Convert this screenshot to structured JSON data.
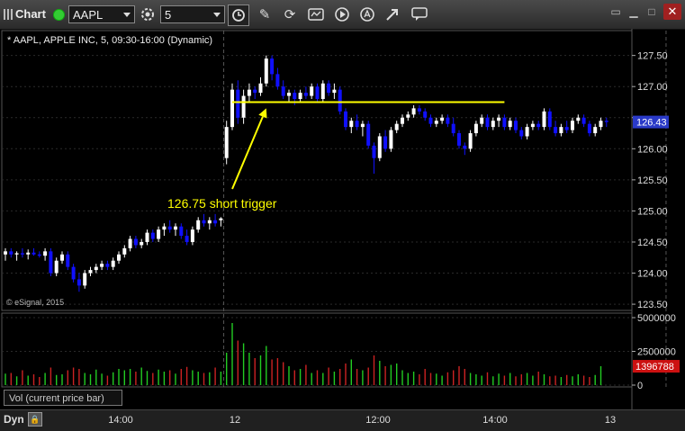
{
  "window": {
    "title": "Chart",
    "symbol": "AAPL",
    "interval": "5",
    "icons": [
      "clock-icon",
      "pencil-icon",
      "refresh-icon",
      "study-icon",
      "play-icon",
      "alert-icon",
      "link-icon",
      "comment-icon"
    ]
  },
  "chart_data": [
    {
      "type": "candlestick",
      "title": "* AAPL, APPLE INC, 5, 09:30-16:00 (Dynamic)",
      "watermark": "© eSignal, 2015",
      "y_ticks": [
        123.5,
        124.0,
        124.5,
        125.0,
        125.5,
        126.0,
        126.5,
        127.0,
        127.5
      ],
      "y_tick_labels": [
        "123.50",
        "124.00",
        "124.50",
        "125.00",
        "125.50",
        "126.00",
        "",
        "127.00",
        "127.50"
      ],
      "ylim": [
        123.4,
        127.9
      ],
      "x_tick_labels": [
        "14:00",
        "12",
        "12:00",
        "14:00",
        "13"
      ],
      "last_price": 126.43,
      "last_price_label": "126.43",
      "colors": {
        "up": "#ffffff",
        "down": "#1010ff",
        "horizontal_line": "#ffff00",
        "annotation": "#ffff00",
        "last_price_box": "#2a3ac8"
      },
      "horizontal_line": {
        "value": 126.75,
        "from_bar": 40,
        "to_bar": 88
      },
      "annotation": {
        "text": "126.75 short trigger",
        "arrow_to_bar": 46,
        "arrow_to_value": 126.65
      },
      "session_breaks": [
        38,
        116
      ],
      "candles": [
        [
          124.3,
          124.4,
          124.2,
          124.35
        ],
        [
          124.35,
          124.4,
          124.25,
          124.3
        ],
        [
          124.3,
          124.35,
          124.2,
          124.32
        ],
        [
          124.32,
          124.4,
          124.25,
          124.3
        ],
        [
          124.3,
          124.38,
          124.22,
          124.33
        ],
        [
          124.33,
          124.4,
          124.28,
          124.3
        ],
        [
          124.3,
          124.35,
          124.25,
          124.28
        ],
        [
          124.28,
          124.4,
          124.2,
          124.35
        ],
        [
          124.35,
          124.4,
          123.95,
          124.0
        ],
        [
          124.0,
          124.25,
          123.95,
          124.2
        ],
        [
          124.2,
          124.35,
          124.15,
          124.3
        ],
        [
          124.3,
          124.35,
          124.05,
          124.1
        ],
        [
          124.1,
          124.15,
          123.85,
          123.9
        ],
        [
          123.9,
          124.0,
          123.7,
          123.8
        ],
        [
          123.8,
          124.05,
          123.75,
          124.0
        ],
        [
          124.0,
          124.1,
          123.95,
          124.05
        ],
        [
          124.05,
          124.15,
          124.0,
          124.1
        ],
        [
          124.1,
          124.2,
          124.05,
          124.15
        ],
        [
          124.15,
          124.2,
          124.05,
          124.1
        ],
        [
          124.1,
          124.25,
          124.05,
          124.2
        ],
        [
          124.2,
          124.35,
          124.15,
          124.3
        ],
        [
          124.3,
          124.45,
          124.25,
          124.4
        ],
        [
          124.4,
          124.6,
          124.35,
          124.55
        ],
        [
          124.55,
          124.6,
          124.4,
          124.45
        ],
        [
          124.45,
          124.55,
          124.4,
          124.5
        ],
        [
          124.5,
          124.7,
          124.45,
          124.65
        ],
        [
          124.65,
          124.7,
          124.5,
          124.55
        ],
        [
          124.55,
          124.75,
          124.5,
          124.7
        ],
        [
          124.7,
          124.8,
          124.6,
          124.75
        ],
        [
          124.75,
          124.85,
          124.65,
          124.7
        ],
        [
          124.7,
          124.8,
          124.6,
          124.75
        ],
        [
          124.75,
          124.8,
          124.55,
          124.6
        ],
        [
          124.6,
          124.7,
          124.45,
          124.5
        ],
        [
          124.5,
          124.75,
          124.45,
          124.7
        ],
        [
          124.7,
          124.9,
          124.65,
          124.85
        ],
        [
          124.85,
          124.95,
          124.75,
          124.8
        ],
        [
          124.8,
          124.9,
          124.7,
          124.85
        ],
        [
          124.85,
          124.95,
          124.75,
          124.8
        ],
        [
          124.85,
          124.9,
          124.75,
          124.88
        ],
        [
          125.85,
          126.45,
          125.75,
          126.35
        ],
        [
          126.35,
          127.05,
          126.3,
          126.95
        ],
        [
          126.95,
          127.1,
          126.4,
          126.5
        ],
        [
          126.5,
          126.95,
          126.4,
          126.85
        ],
        [
          126.85,
          127.05,
          126.75,
          126.95
        ],
        [
          126.95,
          127.0,
          126.8,
          126.9
        ],
        [
          126.9,
          127.15,
          126.85,
          127.05
        ],
        [
          127.05,
          127.5,
          127.0,
          127.45
        ],
        [
          127.45,
          127.5,
          127.1,
          127.2
        ],
        [
          127.2,
          127.3,
          126.95,
          127.0
        ],
        [
          127.0,
          127.1,
          126.8,
          126.85
        ],
        [
          126.85,
          126.95,
          126.75,
          126.9
        ],
        [
          126.9,
          126.95,
          126.7,
          126.8
        ],
        [
          126.8,
          126.95,
          126.75,
          126.9
        ],
        [
          126.9,
          127.0,
          126.8,
          126.85
        ],
        [
          126.85,
          127.05,
          126.8,
          127.0
        ],
        [
          127.0,
          127.05,
          126.75,
          126.8
        ],
        [
          126.8,
          127.1,
          126.75,
          127.05
        ],
        [
          127.05,
          127.1,
          126.85,
          126.9
        ],
        [
          126.9,
          127.05,
          126.8,
          126.95
        ],
        [
          126.95,
          127.0,
          126.55,
          126.6
        ],
        [
          126.6,
          126.65,
          126.3,
          126.35
        ],
        [
          126.35,
          126.5,
          126.25,
          126.45
        ],
        [
          126.45,
          126.55,
          126.3,
          126.35
        ],
        [
          126.35,
          126.45,
          126.2,
          126.4
        ],
        [
          126.4,
          126.45,
          126.0,
          126.05
        ],
        [
          126.05,
          126.1,
          125.6,
          125.85
        ],
        [
          125.85,
          126.25,
          125.8,
          126.2
        ],
        [
          126.2,
          126.3,
          125.95,
          126.0
        ],
        [
          126.0,
          126.35,
          125.95,
          126.3
        ],
        [
          126.3,
          126.45,
          126.25,
          126.4
        ],
        [
          126.4,
          126.55,
          126.35,
          126.5
        ],
        [
          126.5,
          126.6,
          126.45,
          126.55
        ],
        [
          126.55,
          126.7,
          126.5,
          126.65
        ],
        [
          126.65,
          126.7,
          126.55,
          126.6
        ],
        [
          126.6,
          126.65,
          126.45,
          126.5
        ],
        [
          126.5,
          126.55,
          126.35,
          126.4
        ],
        [
          126.4,
          126.5,
          126.35,
          126.45
        ],
        [
          126.45,
          126.55,
          126.4,
          126.5
        ],
        [
          126.5,
          126.55,
          126.35,
          126.4
        ],
        [
          126.4,
          126.5,
          126.2,
          126.25
        ],
        [
          126.25,
          126.3,
          126.0,
          126.05
        ],
        [
          126.05,
          126.1,
          125.9,
          126.0
        ],
        [
          126.0,
          126.3,
          125.95,
          126.25
        ],
        [
          126.25,
          126.45,
          126.2,
          126.4
        ],
        [
          126.4,
          126.55,
          126.35,
          126.5
        ],
        [
          126.5,
          126.55,
          126.3,
          126.35
        ],
        [
          126.35,
          126.5,
          126.3,
          126.45
        ],
        [
          126.45,
          126.55,
          126.35,
          126.5
        ],
        [
          126.5,
          126.55,
          126.3,
          126.35
        ],
        [
          126.35,
          126.5,
          126.3,
          126.45
        ],
        [
          126.45,
          126.5,
          126.25,
          126.3
        ],
        [
          126.3,
          126.35,
          126.15,
          126.2
        ],
        [
          126.2,
          126.4,
          126.15,
          126.35
        ],
        [
          126.35,
          126.45,
          126.3,
          126.4
        ],
        [
          126.4,
          126.45,
          126.3,
          126.35
        ],
        [
          126.35,
          126.65,
          126.3,
          126.6
        ],
        [
          126.6,
          126.65,
          126.3,
          126.35
        ],
        [
          126.35,
          126.45,
          126.2,
          126.25
        ],
        [
          126.25,
          126.4,
          126.2,
          126.35
        ],
        [
          126.35,
          126.45,
          126.25,
          126.3
        ],
        [
          126.3,
          126.5,
          126.25,
          126.45
        ],
        [
          126.45,
          126.55,
          126.4,
          126.5
        ],
        [
          126.5,
          126.55,
          126.35,
          126.4
        ],
        [
          126.4,
          126.45,
          126.2,
          126.25
        ],
        [
          126.25,
          126.4,
          126.2,
          126.35
        ],
        [
          126.35,
          126.5,
          126.3,
          126.45
        ],
        [
          126.45,
          126.5,
          126.35,
          126.43
        ]
      ]
    },
    {
      "type": "bar",
      "title": "Vol (current price bar)",
      "y_ticks": [
        0,
        2500000,
        5000000
      ],
      "y_tick_labels": [
        "0",
        "2500000",
        "5000000"
      ],
      "ylim": [
        0,
        5200000
      ],
      "last_volume": 1396788,
      "last_volume_label": "1396788",
      "colors": {
        "up": "#22cc22",
        "down": "#cc2222",
        "last_box": "#cc1111"
      },
      "values": [
        850000,
        900000,
        650000,
        1100000,
        700000,
        800000,
        600000,
        900000,
        1300000,
        750000,
        800000,
        1100000,
        1300000,
        1200000,
        900000,
        800000,
        1150000,
        850000,
        700000,
        950000,
        1200000,
        1100000,
        1200000,
        1000000,
        1300000,
        1050000,
        900000,
        1150000,
        1000000,
        1100000,
        850000,
        1200000,
        1350000,
        1100000,
        1000000,
        900000,
        950000,
        1300000,
        1000000,
        2400000,
        4600000,
        3300000,
        3100000,
        2400000,
        2000000,
        2200000,
        2900000,
        1900000,
        2000000,
        1700000,
        1400000,
        1100000,
        1200000,
        1500000,
        900000,
        1100000,
        900000,
        1300000,
        1000000,
        1200000,
        1600000,
        1900000,
        1200000,
        1100000,
        1300000,
        2200000,
        1800000,
        1400000,
        1500000,
        1600000,
        1100000,
        900000,
        1000000,
        800000,
        1200000,
        900000,
        850000,
        700000,
        950000,
        1100000,
        1400000,
        1200000,
        900000,
        800000,
        700000,
        950000,
        650000,
        850000,
        700000,
        900000,
        650000,
        800000,
        900000,
        700000,
        1000000,
        800000,
        650000,
        700000,
        600000,
        750000,
        650000,
        800000,
        700000,
        600000,
        750000,
        1400000
      ]
    }
  ]
}
